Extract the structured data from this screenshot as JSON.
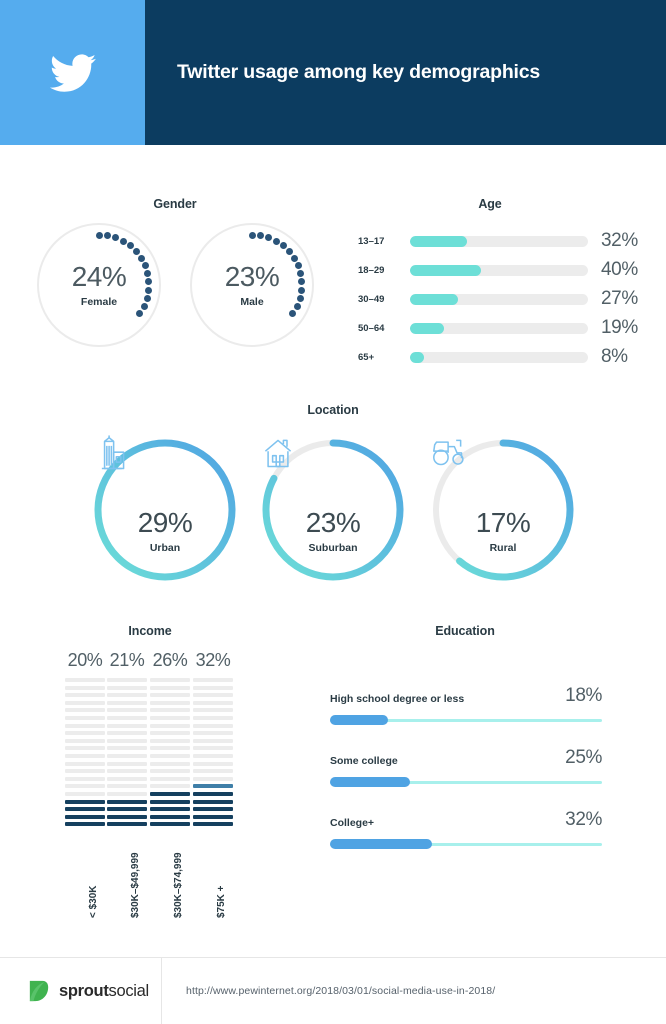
{
  "header": {
    "logo_icon": "twitter-bird-icon",
    "title": "Twitter usage among key demographics",
    "logo_bg": "#55acee",
    "title_bg": "#0c3c60"
  },
  "sections": {
    "gender": {
      "title": "Gender"
    },
    "age": {
      "title": "Age"
    },
    "location": {
      "title": "Location"
    },
    "income": {
      "title": "Income"
    },
    "education": {
      "title": "Education"
    }
  },
  "chart_data": [
    {
      "type": "pie",
      "title": "Gender",
      "style": "dotted-donut",
      "accent": "#2b5479",
      "track": "#ebebeb",
      "categories": [
        "Female",
        "Male"
      ],
      "values": [
        24,
        23
      ],
      "labels": [
        "24%",
        "23%"
      ]
    },
    {
      "type": "bar",
      "title": "Age",
      "orientation": "horizontal",
      "accent": "#6ddfd7",
      "track": "#ececec",
      "categories": [
        "13–17",
        "18–29",
        "30–49",
        "50–64",
        "65+"
      ],
      "values": [
        32,
        40,
        27,
        19,
        8
      ],
      "labels": [
        "32%",
        "40%",
        "27%",
        "19%",
        "8%"
      ],
      "xlabel": "",
      "ylabel": "",
      "ylim": [
        0,
        100
      ],
      "grid": false
    },
    {
      "type": "pie",
      "title": "Location",
      "style": "arc-donut",
      "gradient_from": "#6ddfd7",
      "gradient_to": "#4fa3e3",
      "track": "#ebebeb",
      "categories": [
        "Urban",
        "Suburban",
        "Rural"
      ],
      "values": [
        29,
        23,
        17
      ],
      "labels": [
        "29%",
        "23%",
        "17%"
      ],
      "icons": [
        "city-buildings-icon",
        "house-icon",
        "tractor-icon"
      ]
    },
    {
      "type": "bar",
      "title": "Income",
      "orientation": "vertical",
      "style": "segmented",
      "accent": "#15405f",
      "partial": "#3f7fa8",
      "track": "#ececec",
      "segments_total": 20,
      "categories": [
        "< $30K",
        "$30K–$49,999",
        "$30K–$74,999",
        "$75K +"
      ],
      "values": [
        20,
        21,
        26,
        32
      ],
      "labels": [
        "20%",
        "21%",
        "26%",
        "32%"
      ],
      "filled_segments": [
        4,
        4,
        5,
        6
      ],
      "xlabel": "",
      "ylabel": "",
      "ylim": [
        0,
        100
      ],
      "grid": false
    },
    {
      "type": "bar",
      "title": "Education",
      "orientation": "horizontal",
      "accent": "#4fa3e3",
      "track": "#a8f0ec",
      "categories": [
        "High school degree or less",
        "Some college",
        "College+"
      ],
      "values": [
        18,
        25,
        32
      ],
      "labels": [
        "18%",
        "25%",
        "32%"
      ],
      "xlabel": "",
      "ylabel": "",
      "ylim": [
        0,
        100
      ],
      "grid": false
    }
  ],
  "gender": {
    "items": [
      {
        "pct": "24%",
        "label": "Female",
        "value": 24
      },
      {
        "pct": "23%",
        "label": "Male",
        "value": 23
      }
    ]
  },
  "age": {
    "rows": [
      {
        "label": "13–17",
        "pct": "32%",
        "value": 32
      },
      {
        "label": "18–29",
        "pct": "40%",
        "value": 40
      },
      {
        "label": "30–49",
        "pct": "27%",
        "value": 27
      },
      {
        "label": "50–64",
        "pct": "19%",
        "value": 19
      },
      {
        "label": "65+",
        "pct": "8%",
        "value": 8
      }
    ]
  },
  "location": {
    "items": [
      {
        "pct": "29%",
        "label": "Urban",
        "value": 29,
        "icon": "city-buildings-icon"
      },
      {
        "pct": "23%",
        "label": "Suburban",
        "value": 23,
        "icon": "house-icon"
      },
      {
        "pct": "17%",
        "label": "Rural",
        "value": 17,
        "icon": "tractor-icon"
      }
    ]
  },
  "income": {
    "columns": [
      {
        "pct": "20%",
        "xlabel": "< $30K",
        "value": 20,
        "filled": 4,
        "partial": false
      },
      {
        "pct": "21%",
        "xlabel": "$30K–$49,999",
        "value": 21,
        "filled": 4,
        "partial": false
      },
      {
        "pct": "26%",
        "xlabel": "$30K–$74,999",
        "value": 26,
        "filled": 5,
        "partial": false
      },
      {
        "pct": "32%",
        "xlabel": "$75K +",
        "value": 32,
        "filled": 6,
        "partial": true
      }
    ]
  },
  "education": {
    "rows": [
      {
        "label": "High school degree or less",
        "pct": "18%",
        "value": 18
      },
      {
        "label": "Some college",
        "pct": "25%",
        "value": 25
      },
      {
        "label": "College+",
        "pct": "32%",
        "value": 32
      }
    ]
  },
  "footer": {
    "logo_icon": "sprout-leaf-icon",
    "brand_bold": "sprout",
    "brand_light": "social",
    "source_url": "http://www.pewinternet.org/2018/03/01/social-media-use-in-2018/"
  }
}
